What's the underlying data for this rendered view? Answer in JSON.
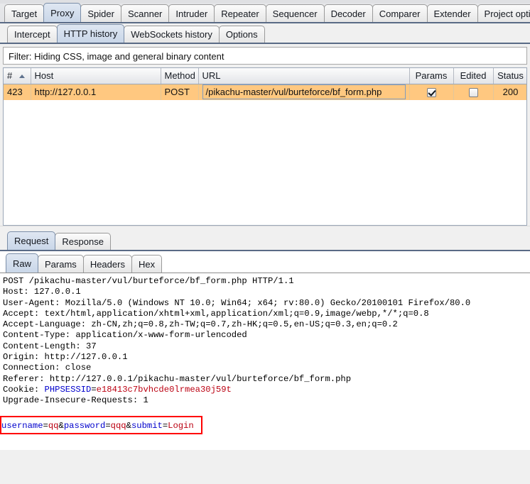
{
  "app": {
    "name": "Burp Suite",
    "accent_selected_tab": "#c9d6e8",
    "accent_row_selected": "#ffc880",
    "accent_highlight_box": "#ff0000"
  },
  "primary_tabs": [
    {
      "label": "Target",
      "selected": false
    },
    {
      "label": "Proxy",
      "selected": true
    },
    {
      "label": "Spider",
      "selected": false
    },
    {
      "label": "Scanner",
      "selected": false
    },
    {
      "label": "Intruder",
      "selected": false
    },
    {
      "label": "Repeater",
      "selected": false
    },
    {
      "label": "Sequencer",
      "selected": false
    },
    {
      "label": "Decoder",
      "selected": false
    },
    {
      "label": "Comparer",
      "selected": false
    },
    {
      "label": "Extender",
      "selected": false
    },
    {
      "label": "Project options",
      "selected": false
    }
  ],
  "secondary_tabs": [
    {
      "label": "Intercept",
      "selected": false
    },
    {
      "label": "HTTP history",
      "selected": true
    },
    {
      "label": "WebSockets history",
      "selected": false
    },
    {
      "label": "Options",
      "selected": false
    }
  ],
  "filter": {
    "text": "Filter: Hiding CSS, image and general binary content"
  },
  "history_table": {
    "columns": [
      {
        "key": "num",
        "label": "#",
        "sorted": true,
        "sort_dir": "asc"
      },
      {
        "key": "host",
        "label": "Host"
      },
      {
        "key": "method",
        "label": "Method"
      },
      {
        "key": "url",
        "label": "URL"
      },
      {
        "key": "params",
        "label": "Params"
      },
      {
        "key": "edited",
        "label": "Edited"
      },
      {
        "key": "status",
        "label": "Status"
      }
    ],
    "rows": [
      {
        "num": "423",
        "host": "http://127.0.0.1",
        "method": "POST",
        "url": "/pikachu-master/vul/burteforce/bf_form.php",
        "params": true,
        "edited": false,
        "status": "200",
        "selected": true
      }
    ]
  },
  "message_tabs": [
    {
      "label": "Request",
      "selected": true
    },
    {
      "label": "Response",
      "selected": false
    }
  ],
  "view_tabs": [
    {
      "label": "Raw",
      "selected": true
    },
    {
      "label": "Params",
      "selected": false
    },
    {
      "label": "Headers",
      "selected": false
    },
    {
      "label": "Hex",
      "selected": false
    }
  ],
  "request": {
    "request_line": "POST /pikachu-master/vul/burteforce/bf_form.php HTTP/1.1",
    "headers": [
      "Host: 127.0.0.1",
      "User-Agent: Mozilla/5.0 (Windows NT 10.0; Win64; x64; rv:80.0) Gecko/20100101 Firefox/80.0",
      "Accept: text/html,application/xhtml+xml,application/xml;q=0.9,image/webp,*/*;q=0.8",
      "Accept-Language: zh-CN,zh;q=0.8,zh-TW;q=0.7,zh-HK;q=0.5,en-US;q=0.3,en;q=0.2",
      "Content-Type: application/x-www-form-urlencoded",
      "Content-Length: 37",
      "Origin: http://127.0.0.1",
      "Connection: close",
      "Referer: http://127.0.0.1/pikachu-master/vul/burteforce/bf_form.php"
    ],
    "cookie_label": "Cookie: ",
    "cookie_name": "PHPSESSID",
    "cookie_eq": "=",
    "cookie_value": "e18413c7bvhcde0lrmea30j59t",
    "trailing_header": "Upgrade-Insecure-Requests: 1",
    "body": {
      "p1_name": "username",
      "p1_eq": "=",
      "p1_val": "qq",
      "amp1": "&",
      "p2_name": "password",
      "p2_eq": "=",
      "p2_val": "qqq",
      "amp2": "&",
      "p3_name": "submit",
      "p3_eq": "=",
      "p3_val": "Login"
    }
  }
}
